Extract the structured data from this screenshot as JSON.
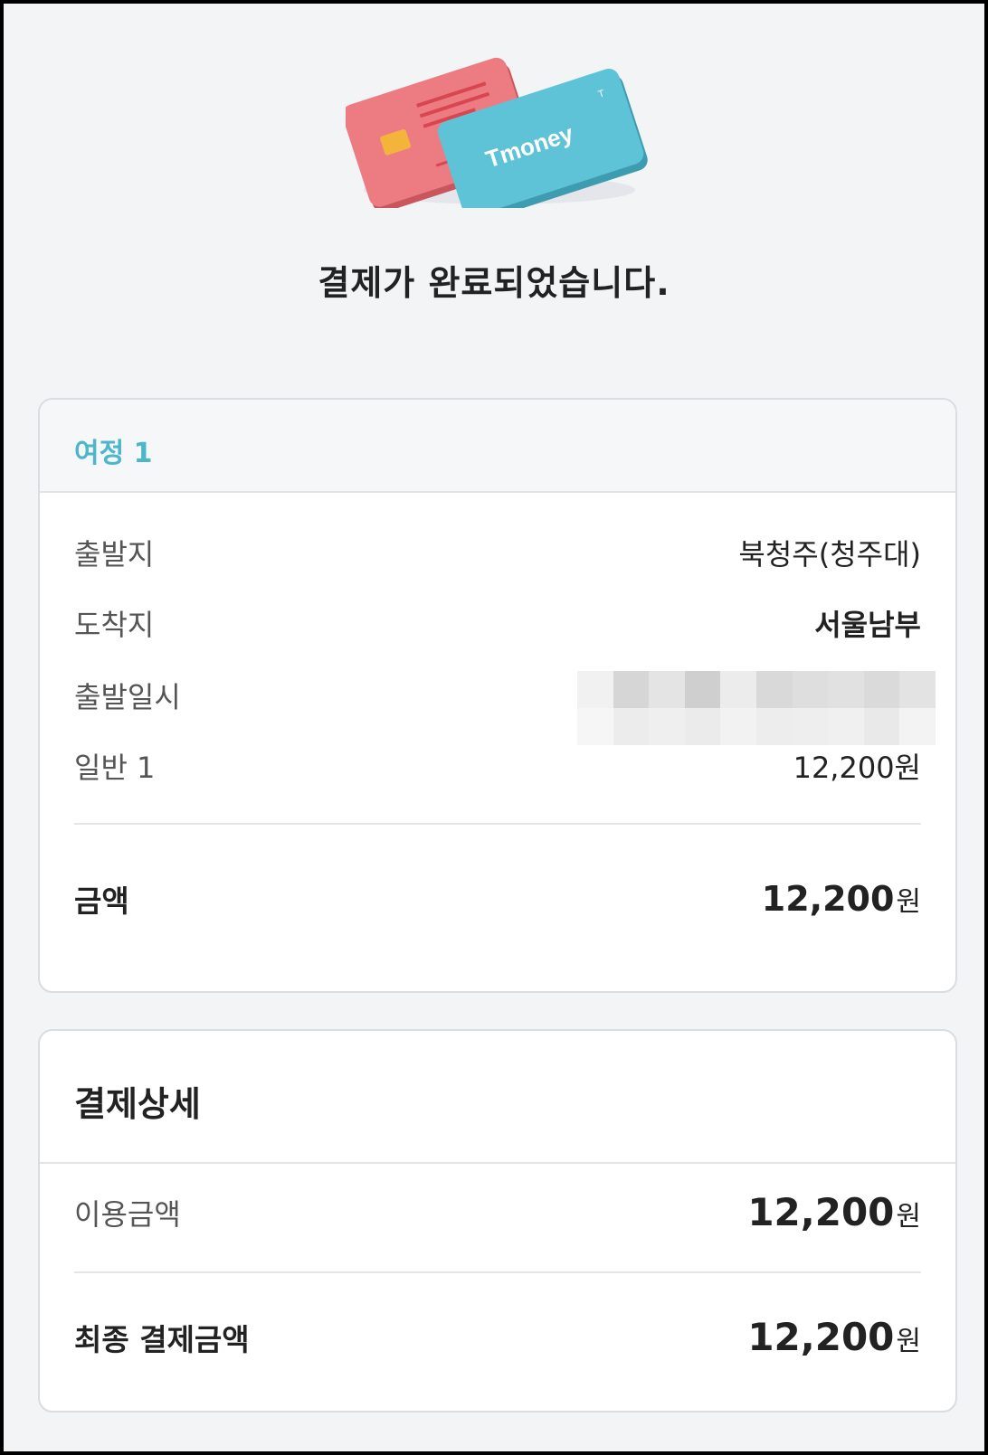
{
  "hero": {
    "card_brand": "Tmoney",
    "card_brand_mark": "T",
    "title": "결제가 완료되었습니다."
  },
  "trip": {
    "header": "여정 1",
    "rows": [
      {
        "label": "출발지",
        "value": "북청주(청주대)"
      },
      {
        "label": "도착지",
        "value": "서울남부"
      },
      {
        "label": "출발일시",
        "value": ""
      },
      {
        "label": "일반 1",
        "value": "12,200원"
      }
    ],
    "total_label": "금액",
    "total_value": "12,200",
    "total_unit": "원"
  },
  "payment_detail": {
    "header": "결제상세",
    "usage_label": "이용금액",
    "usage_value": "12,200",
    "usage_unit": "원",
    "final_label": "최종 결제금액",
    "final_value": "12,200",
    "final_unit": "원"
  },
  "colors": {
    "accent": "#4db6cc",
    "card_red": "#e97a7f",
    "card_teal": "#5bbfd3",
    "chip": "#f2b43c"
  }
}
